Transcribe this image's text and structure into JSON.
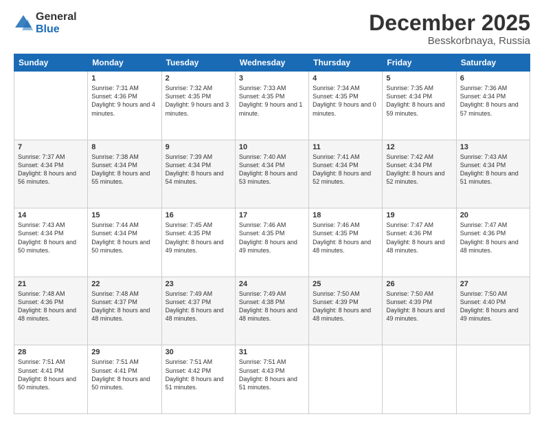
{
  "logo": {
    "general": "General",
    "blue": "Blue"
  },
  "header": {
    "month": "December 2025",
    "location": "Besskorbnaya, Russia"
  },
  "weekdays": [
    "Sunday",
    "Monday",
    "Tuesday",
    "Wednesday",
    "Thursday",
    "Friday",
    "Saturday"
  ],
  "weeks": [
    [
      {
        "day": "",
        "sunrise": "",
        "sunset": "",
        "daylight": ""
      },
      {
        "day": "1",
        "sunrise": "Sunrise: 7:31 AM",
        "sunset": "Sunset: 4:36 PM",
        "daylight": "Daylight: 9 hours and 4 minutes."
      },
      {
        "day": "2",
        "sunrise": "Sunrise: 7:32 AM",
        "sunset": "Sunset: 4:35 PM",
        "daylight": "Daylight: 9 hours and 3 minutes."
      },
      {
        "day": "3",
        "sunrise": "Sunrise: 7:33 AM",
        "sunset": "Sunset: 4:35 PM",
        "daylight": "Daylight: 9 hours and 1 minute."
      },
      {
        "day": "4",
        "sunrise": "Sunrise: 7:34 AM",
        "sunset": "Sunset: 4:35 PM",
        "daylight": "Daylight: 9 hours and 0 minutes."
      },
      {
        "day": "5",
        "sunrise": "Sunrise: 7:35 AM",
        "sunset": "Sunset: 4:34 PM",
        "daylight": "Daylight: 8 hours and 59 minutes."
      },
      {
        "day": "6",
        "sunrise": "Sunrise: 7:36 AM",
        "sunset": "Sunset: 4:34 PM",
        "daylight": "Daylight: 8 hours and 57 minutes."
      }
    ],
    [
      {
        "day": "7",
        "sunrise": "Sunrise: 7:37 AM",
        "sunset": "Sunset: 4:34 PM",
        "daylight": "Daylight: 8 hours and 56 minutes."
      },
      {
        "day": "8",
        "sunrise": "Sunrise: 7:38 AM",
        "sunset": "Sunset: 4:34 PM",
        "daylight": "Daylight: 8 hours and 55 minutes."
      },
      {
        "day": "9",
        "sunrise": "Sunrise: 7:39 AM",
        "sunset": "Sunset: 4:34 PM",
        "daylight": "Daylight: 8 hours and 54 minutes."
      },
      {
        "day": "10",
        "sunrise": "Sunrise: 7:40 AM",
        "sunset": "Sunset: 4:34 PM",
        "daylight": "Daylight: 8 hours and 53 minutes."
      },
      {
        "day": "11",
        "sunrise": "Sunrise: 7:41 AM",
        "sunset": "Sunset: 4:34 PM",
        "daylight": "Daylight: 8 hours and 52 minutes."
      },
      {
        "day": "12",
        "sunrise": "Sunrise: 7:42 AM",
        "sunset": "Sunset: 4:34 PM",
        "daylight": "Daylight: 8 hours and 52 minutes."
      },
      {
        "day": "13",
        "sunrise": "Sunrise: 7:43 AM",
        "sunset": "Sunset: 4:34 PM",
        "daylight": "Daylight: 8 hours and 51 minutes."
      }
    ],
    [
      {
        "day": "14",
        "sunrise": "Sunrise: 7:43 AM",
        "sunset": "Sunset: 4:34 PM",
        "daylight": "Daylight: 8 hours and 50 minutes."
      },
      {
        "day": "15",
        "sunrise": "Sunrise: 7:44 AM",
        "sunset": "Sunset: 4:34 PM",
        "daylight": "Daylight: 8 hours and 50 minutes."
      },
      {
        "day": "16",
        "sunrise": "Sunrise: 7:45 AM",
        "sunset": "Sunset: 4:35 PM",
        "daylight": "Daylight: 8 hours and 49 minutes."
      },
      {
        "day": "17",
        "sunrise": "Sunrise: 7:46 AM",
        "sunset": "Sunset: 4:35 PM",
        "daylight": "Daylight: 8 hours and 49 minutes."
      },
      {
        "day": "18",
        "sunrise": "Sunrise: 7:46 AM",
        "sunset": "Sunset: 4:35 PM",
        "daylight": "Daylight: 8 hours and 48 minutes."
      },
      {
        "day": "19",
        "sunrise": "Sunrise: 7:47 AM",
        "sunset": "Sunset: 4:36 PM",
        "daylight": "Daylight: 8 hours and 48 minutes."
      },
      {
        "day": "20",
        "sunrise": "Sunrise: 7:47 AM",
        "sunset": "Sunset: 4:36 PM",
        "daylight": "Daylight: 8 hours and 48 minutes."
      }
    ],
    [
      {
        "day": "21",
        "sunrise": "Sunrise: 7:48 AM",
        "sunset": "Sunset: 4:36 PM",
        "daylight": "Daylight: 8 hours and 48 minutes."
      },
      {
        "day": "22",
        "sunrise": "Sunrise: 7:48 AM",
        "sunset": "Sunset: 4:37 PM",
        "daylight": "Daylight: 8 hours and 48 minutes."
      },
      {
        "day": "23",
        "sunrise": "Sunrise: 7:49 AM",
        "sunset": "Sunset: 4:37 PM",
        "daylight": "Daylight: 8 hours and 48 minutes."
      },
      {
        "day": "24",
        "sunrise": "Sunrise: 7:49 AM",
        "sunset": "Sunset: 4:38 PM",
        "daylight": "Daylight: 8 hours and 48 minutes."
      },
      {
        "day": "25",
        "sunrise": "Sunrise: 7:50 AM",
        "sunset": "Sunset: 4:39 PM",
        "daylight": "Daylight: 8 hours and 48 minutes."
      },
      {
        "day": "26",
        "sunrise": "Sunrise: 7:50 AM",
        "sunset": "Sunset: 4:39 PM",
        "daylight": "Daylight: 8 hours and 49 minutes."
      },
      {
        "day": "27",
        "sunrise": "Sunrise: 7:50 AM",
        "sunset": "Sunset: 4:40 PM",
        "daylight": "Daylight: 8 hours and 49 minutes."
      }
    ],
    [
      {
        "day": "28",
        "sunrise": "Sunrise: 7:51 AM",
        "sunset": "Sunset: 4:41 PM",
        "daylight": "Daylight: 8 hours and 50 minutes."
      },
      {
        "day": "29",
        "sunrise": "Sunrise: 7:51 AM",
        "sunset": "Sunset: 4:41 PM",
        "daylight": "Daylight: 8 hours and 50 minutes."
      },
      {
        "day": "30",
        "sunrise": "Sunrise: 7:51 AM",
        "sunset": "Sunset: 4:42 PM",
        "daylight": "Daylight: 8 hours and 51 minutes."
      },
      {
        "day": "31",
        "sunrise": "Sunrise: 7:51 AM",
        "sunset": "Sunset: 4:43 PM",
        "daylight": "Daylight: 8 hours and 51 minutes."
      },
      {
        "day": "",
        "sunrise": "",
        "sunset": "",
        "daylight": ""
      },
      {
        "day": "",
        "sunrise": "",
        "sunset": "",
        "daylight": ""
      },
      {
        "day": "",
        "sunrise": "",
        "sunset": "",
        "daylight": ""
      }
    ]
  ]
}
